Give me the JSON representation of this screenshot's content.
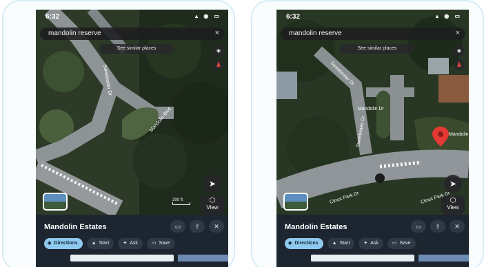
{
  "panels": [
    {
      "status": {
        "time": "6:32",
        "icons": "▴ ◉ ▭"
      },
      "search": {
        "query": "mandolin reserve",
        "close": "×"
      },
      "chip_similar": "See similar places",
      "map_labels": [
        "Sweetwater Dr",
        "Mandolin Blvd"
      ],
      "scale_text": "200 ft",
      "view_label": "View",
      "place_title": "Mandolin Estates",
      "sheet_icons": [
        "▭",
        "⇧",
        "✕"
      ],
      "actions": [
        {
          "icon": "◈",
          "label": "Directions"
        },
        {
          "icon": "▲",
          "label": "Start"
        },
        {
          "icon": "✦",
          "label": "Ask"
        },
        {
          "icon": "▭",
          "label": "Save"
        }
      ]
    },
    {
      "status": {
        "time": "6:32",
        "icons": "▴ ◉ ▭"
      },
      "search": {
        "query": "mandolin reserve",
        "close": "×"
      },
      "chip_similar": "See similar places",
      "map_labels": [
        "Sweetwater Dr",
        "Mandolin Dr",
        "Mandolin",
        "Citrus Park Dr",
        "Citrus Park Dr",
        "Sweetwater Dr"
      ],
      "view_label": "View",
      "place_title": "Mandolin Estates",
      "sheet_icons": [
        "▭",
        "⇧",
        "✕"
      ],
      "actions": [
        {
          "icon": "◈",
          "label": "Directions"
        },
        {
          "icon": "▲",
          "label": "Start"
        },
        {
          "icon": "✦",
          "label": "Ask"
        },
        {
          "icon": "▭",
          "label": "Save"
        }
      ]
    }
  ],
  "colors": {
    "frame_border": "#d6ecf5",
    "sheet_bg": "#1d2530",
    "directions_chip": "#8ec9ef",
    "pin": "#e53935"
  },
  "icons": [
    "close-icon",
    "layers-icon",
    "compass-icon",
    "locate-icon",
    "view-3d-icon",
    "share-icon",
    "directions-icon",
    "start-icon",
    "ask-icon",
    "save-icon",
    "location-pin-icon"
  ]
}
